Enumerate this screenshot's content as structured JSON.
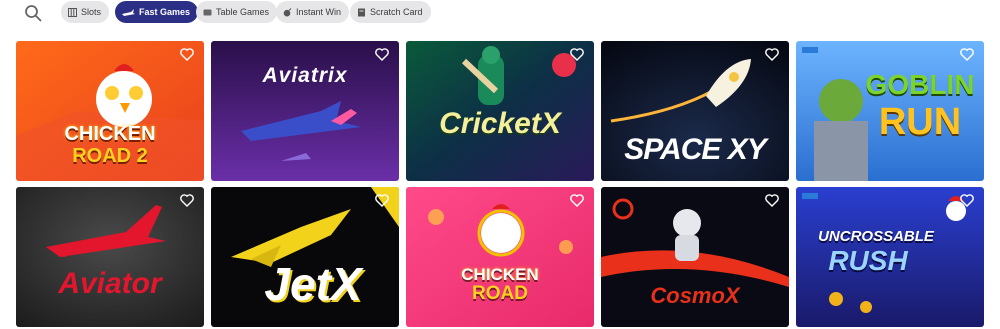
{
  "filters": {
    "chips": [
      {
        "label": "Slots",
        "icon": "slots-icon",
        "active": false
      },
      {
        "label": "Fast Games",
        "icon": "plane-icon",
        "active": true
      },
      {
        "label": "Table Games",
        "icon": "table-icon",
        "active": false
      },
      {
        "label": "Instant Win",
        "icon": "bomb-icon",
        "active": false
      },
      {
        "label": "Scratch Card",
        "icon": "scratch-icon",
        "active": false
      }
    ]
  },
  "games": [
    {
      "title_lines": [
        "CHICKEN",
        "ROAD 2"
      ],
      "icon": "chicken-icon"
    },
    {
      "title_lines": [
        "Aviatrix"
      ],
      "icon": "jet-icon"
    },
    {
      "title_lines": [
        "CricketX"
      ],
      "icon": "cricket-player-icon"
    },
    {
      "title_lines": [
        "SPACE XY"
      ],
      "icon": "rocket-icon"
    },
    {
      "title_lines": [
        "GOBLIN",
        "RUN"
      ],
      "icon": "goblin-icon"
    },
    {
      "title_lines": [
        "Aviator"
      ],
      "icon": "plane-icon"
    },
    {
      "title_lines": [
        "JetX"
      ],
      "icon": "jet-icon"
    },
    {
      "title_lines": [
        "CHICKEN",
        "ROAD"
      ],
      "icon": "chicken-icon"
    },
    {
      "title_lines": [
        "CosmoX"
      ],
      "icon": "astronaut-icon"
    },
    {
      "title_lines": [
        "UNCROSSABLE",
        "RUSH"
      ],
      "icon": "rooster-icon"
    }
  ],
  "colors": {
    "active_chip": "#2b2f86",
    "chip_bg": "#e6e6e9"
  }
}
